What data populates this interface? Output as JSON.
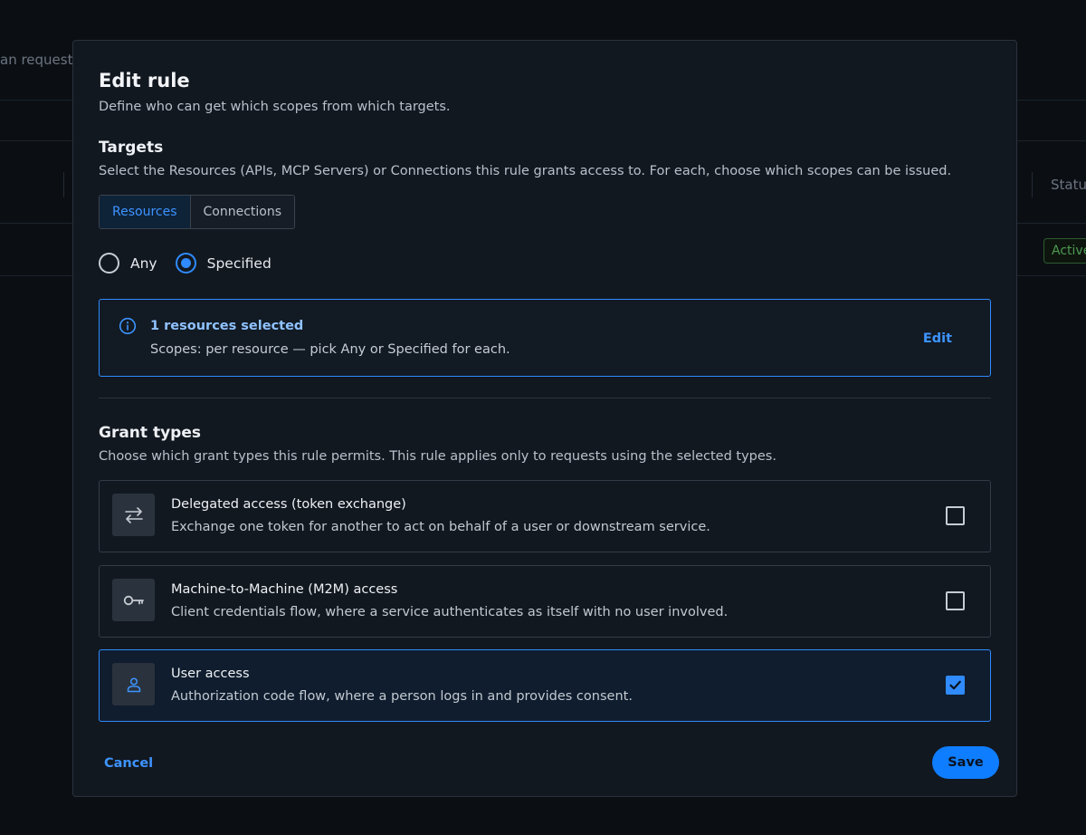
{
  "background": {
    "partial_text": "an request a",
    "column_partial": "Statu",
    "badge_partial": "Active"
  },
  "modal": {
    "title": "Edit rule",
    "subtitle": "Define who can get which scopes from which targets.",
    "targets": {
      "title": "Targets",
      "description": "Select the Resources (APIs, MCP Servers) or Connections this rule grants access to. For each, choose which scopes can be issued.",
      "tabs": [
        {
          "label": "Resources",
          "active": true
        },
        {
          "label": "Connections",
          "active": false
        }
      ],
      "radios": [
        {
          "label": "Any",
          "selected": false
        },
        {
          "label": "Specified",
          "selected": true
        }
      ],
      "info": {
        "title": "1 resources selected",
        "description": "Scopes: per resource — pick Any or Specified for each.",
        "edit_label": "Edit"
      }
    },
    "grant_types": {
      "title": "Grant types",
      "description": "Choose which grant types this rule permits. This rule applies only to requests using the selected types.",
      "items": [
        {
          "title": "Delegated access (token exchange)",
          "description": "Exchange one token for another to act on behalf of a user or downstream service.",
          "icon": "swap-arrows-icon",
          "checked": false
        },
        {
          "title": "Machine-to-Machine (M2M) access",
          "description": "Client credentials flow, where a service authenticates as itself with no user involved.",
          "icon": "key-icon",
          "checked": false
        },
        {
          "title": "User access",
          "description": "Authorization code flow, where a person logs in and provides consent.",
          "icon": "user-icon",
          "checked": true
        }
      ]
    },
    "footer": {
      "cancel_label": "Cancel",
      "save_label": "Save"
    }
  },
  "colors": {
    "accent": "#2f8bff",
    "background": "#0b0f14",
    "modal": "#121820"
  }
}
